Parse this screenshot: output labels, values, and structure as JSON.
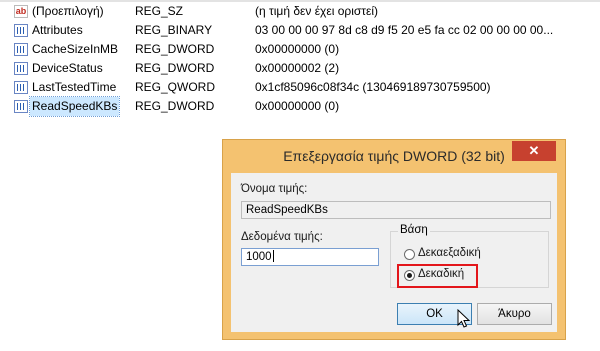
{
  "values": [
    {
      "icon": "string-value-icon",
      "name": "(Προεπιλογή)",
      "type": "REG_SZ",
      "data": "(η τιμή δεν έχει οριστεί)"
    },
    {
      "icon": "binary-value-icon",
      "name": "Attributes",
      "type": "REG_BINARY",
      "data": "03 00 00 00 97 8d c8 d9 f5 20 e5 fa cc 02 00 00 00 00..."
    },
    {
      "icon": "binary-value-icon",
      "name": "CacheSizeInMB",
      "type": "REG_DWORD",
      "data": "0x00000000 (0)"
    },
    {
      "icon": "binary-value-icon",
      "name": "DeviceStatus",
      "type": "REG_DWORD",
      "data": "0x00000002 (2)"
    },
    {
      "icon": "binary-value-icon",
      "name": "LastTestedTime",
      "type": "REG_QWORD",
      "data": "0x1cf85096c08f34c (130469189730759500)"
    },
    {
      "icon": "binary-value-icon",
      "name": "ReadSpeedKBs",
      "type": "REG_DWORD",
      "data": "0x00000000 (0)"
    }
  ],
  "dialog": {
    "title": "Επεξεργασία τιμής DWORD (32 bit)",
    "close_symbol": "✕",
    "value_name_label": "Όνομα τιμής:",
    "value_name": "ReadSpeedKBs",
    "value_data_label": "Δεδομένα τιμής:",
    "value_data": "1000",
    "base_label": "Βάση",
    "hex_label": "Δεκαεξαδική",
    "dec_label": "Δεκαδική",
    "selected_base": "Δεκαδική",
    "ok_label": "OK",
    "cancel_label": "Άκυρο"
  },
  "colors": {
    "dialog_frame": "#f4c270",
    "close_button": "#c7412f",
    "selection": "#cce8ff",
    "highlight_box": "#e3161b"
  }
}
